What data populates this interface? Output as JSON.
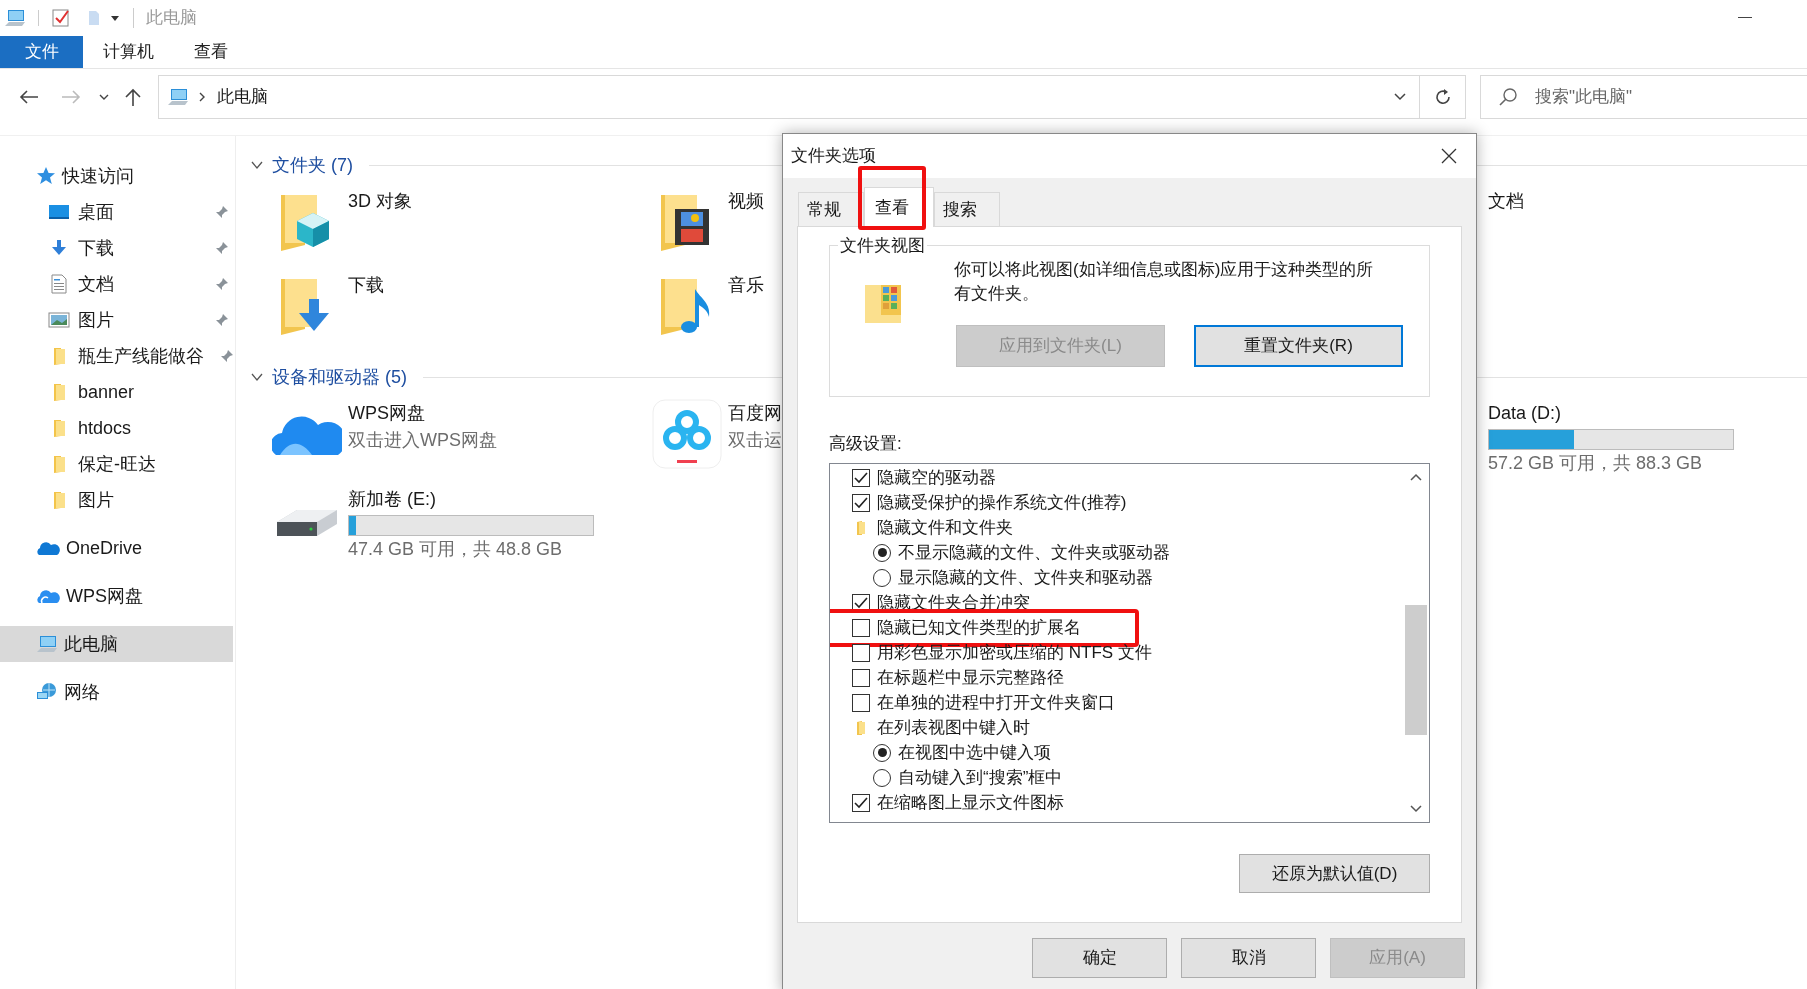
{
  "title_bar": {
    "title": "此电脑"
  },
  "ribbon": {
    "tabs": [
      {
        "label": "文件",
        "selected": true
      },
      {
        "label": "计算机",
        "selected": false
      },
      {
        "label": "查看",
        "selected": false
      }
    ]
  },
  "address_bar": {
    "path": "此电脑",
    "search": {
      "placeholder": "搜索\"此电脑\""
    }
  },
  "sidebar": {
    "items": [
      {
        "label": "快速访问",
        "selected": false,
        "children": [
          {
            "label": "桌面",
            "pinned": true
          },
          {
            "label": "下载",
            "pinned": true
          },
          {
            "label": "文档",
            "pinned": true
          },
          {
            "label": "图片",
            "pinned": true
          },
          {
            "label": "瓶生产线能做谷",
            "pinned": true
          },
          {
            "label": "banner",
            "pinned": false
          },
          {
            "label": "htdocs",
            "pinned": false
          },
          {
            "label": "保定-旺达",
            "pinned": false
          },
          {
            "label": "图片",
            "pinned": false
          }
        ]
      },
      {
        "label": "OneDrive",
        "selected": false
      },
      {
        "label": "WPS网盘",
        "selected": false
      },
      {
        "label": "此电脑",
        "selected": true
      },
      {
        "label": "网络",
        "selected": false
      }
    ]
  },
  "sections": [
    {
      "title": "文件夹 (7)",
      "expanded": true,
      "items": [
        {
          "name": "3D 对象"
        },
        {
          "name": "视频"
        },
        {
          "name": "文档"
        },
        {
          "name": "下载"
        },
        {
          "name": "音乐"
        }
      ]
    },
    {
      "title": "设备和驱动器 (5)",
      "expanded": true,
      "items": [
        {
          "name": "WPS网盘",
          "subtitle": "双击进入WPS网盘"
        },
        {
          "name": "百度网",
          "subtitle": "双击运"
        },
        {
          "name": "Data (D:)",
          "level": 0.35,
          "reading": "57.2 GB 可用，共 88.3 GB"
        },
        {
          "name": "新加卷 (E:)",
          "level": 0.03,
          "reading": "47.4 GB 可用，共 48.8 GB"
        }
      ]
    }
  ],
  "dialog": {
    "title": "文件夹选项",
    "tabs": [
      {
        "label": "常规",
        "selected": false,
        "highlighted": false
      },
      {
        "label": "查看",
        "selected": true,
        "highlighted": true
      },
      {
        "label": "搜索",
        "selected": false,
        "highlighted": false
      }
    ],
    "folder_views": {
      "legend": "文件夹视图",
      "description": "你可以将此视图(如详细信息或图标)应用于这种类型的所有文件夹。",
      "buttons": [
        {
          "label": "应用到文件夹(L)",
          "disabled": true,
          "default": false
        },
        {
          "label": "重置文件夹(R)",
          "disabled": false,
          "default": true
        }
      ]
    },
    "advanced": {
      "label": "高级设置:",
      "options": [
        {
          "kind": "checkbox",
          "label": "隐藏空的驱动器",
          "checked": true,
          "highlighted": false
        },
        {
          "kind": "checkbox",
          "label": "隐藏受保护的操作系统文件(推荐)",
          "checked": true,
          "highlighted": false
        },
        {
          "kind": "group",
          "label": "隐藏文件和文件夹",
          "children": [
            {
              "kind": "radio",
              "label": "不显示隐藏的文件、文件夹或驱动器",
              "selected": true
            },
            {
              "kind": "radio",
              "label": "显示隐藏的文件、文件夹和驱动器",
              "selected": false
            }
          ]
        },
        {
          "kind": "checkbox",
          "label": "隐藏文件夹合并冲突",
          "checked": true,
          "highlighted": false
        },
        {
          "kind": "checkbox",
          "label": "隐藏已知文件类型的扩展名",
          "checked": false,
          "highlighted": true
        },
        {
          "kind": "checkbox",
          "label": "用彩色显示加密或压缩的 NTFS 文件",
          "checked": false,
          "highlighted": false
        },
        {
          "kind": "checkbox",
          "label": "在标题栏中显示完整路径",
          "checked": false,
          "highlighted": false
        },
        {
          "kind": "checkbox",
          "label": "在单独的进程中打开文件夹窗口",
          "checked": false,
          "highlighted": false
        },
        {
          "kind": "group",
          "label": "在列表视图中键入时",
          "children": [
            {
              "kind": "radio",
              "label": "在视图中选中键入项",
              "selected": true
            },
            {
              "kind": "radio",
              "label": "自动键入到“搜索”框中",
              "selected": false
            }
          ]
        },
        {
          "kind": "checkbox",
          "label": "在缩略图上显示文件图标",
          "checked": true,
          "highlighted": false
        }
      ]
    },
    "restore_button": {
      "label": "还原为默认值(D)"
    },
    "buttons": [
      {
        "label": "确定",
        "disabled": false
      },
      {
        "label": "取消",
        "disabled": false
      },
      {
        "label": "应用(A)",
        "disabled": true
      }
    ]
  }
}
